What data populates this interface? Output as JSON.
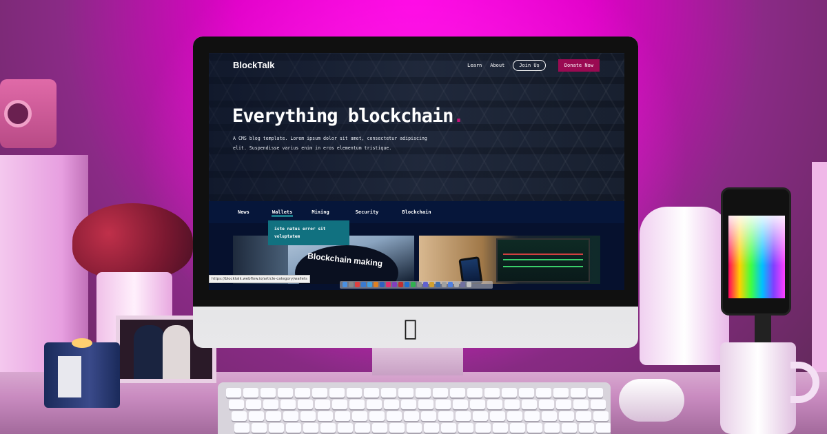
{
  "site": {
    "logo": "BlockTalk",
    "nav": {
      "learn": "Learn",
      "about": "About",
      "join": "Join Us",
      "donate": "Donate Now"
    },
    "hero": {
      "title": "Everything blockchain",
      "title_dot": ".",
      "lead": "A CMS blog template. Lorem ipsum dolor sit amet, consectetur adipiscing elit. Suspendisse varius enim in eros elementum tristique."
    },
    "categories": [
      "News",
      "Wallets",
      "Mining",
      "Security",
      "Blockchain"
    ],
    "active_category": "Wallets",
    "dropdown_text": "iste natus error sit voluptatem",
    "card1_text": "Blockchain making",
    "status_url": "https://blocktalk.webflow.io/article-category/wallets"
  },
  "colors": {
    "accent": "#9a0a52",
    "dropdown": "#117180",
    "navbar": "#06163a",
    "room_glow": "#ff00e6"
  }
}
